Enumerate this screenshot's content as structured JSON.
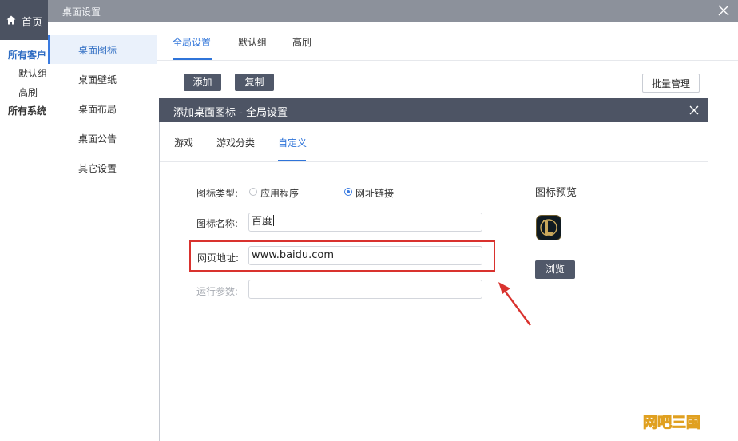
{
  "header": {
    "home_label": "首页",
    "window_title": "桌面设置"
  },
  "sidebar": {
    "items": [
      {
        "label": "所有客户"
      },
      {
        "label": "默认组"
      },
      {
        "label": "高刷"
      },
      {
        "label": "所有系统"
      }
    ]
  },
  "settings_nav": {
    "items": [
      {
        "label": "桌面图标"
      },
      {
        "label": "桌面壁纸"
      },
      {
        "label": "桌面布局"
      },
      {
        "label": "桌面公告"
      },
      {
        "label": "其它设置"
      }
    ],
    "active": "桌面图标"
  },
  "tabs": [
    {
      "label": "全局设置"
    },
    {
      "label": "默认组"
    },
    {
      "label": "高刷"
    }
  ],
  "toolbar": {
    "add_label": "添加",
    "copy_label": "复制",
    "batch_label": "批量管理"
  },
  "dialog": {
    "title": "添加桌面图标 - 全局设置",
    "tabs": [
      {
        "label": "游戏"
      },
      {
        "label": "游戏分类"
      },
      {
        "label": "自定义"
      }
    ],
    "active_tab": "自定义",
    "form": {
      "icon_type_label": "图标类型:",
      "icon_type_options": [
        {
          "label": "应用程序",
          "checked": false
        },
        {
          "label": "网址链接",
          "checked": true
        }
      ],
      "icon_name_label": "图标名称:",
      "icon_name_value": "百度",
      "url_label": "网页地址:",
      "url_value": "www.baidu.com",
      "params_label": "运行参数:",
      "params_value": ""
    },
    "preview": {
      "title": "图标预览",
      "browse_label": "浏览"
    }
  },
  "watermark": {
    "text": "网吧三国"
  },
  "colors": {
    "accent": "#2f74d9",
    "dark_header": "#4d5464",
    "highlight": "#d9322e"
  }
}
